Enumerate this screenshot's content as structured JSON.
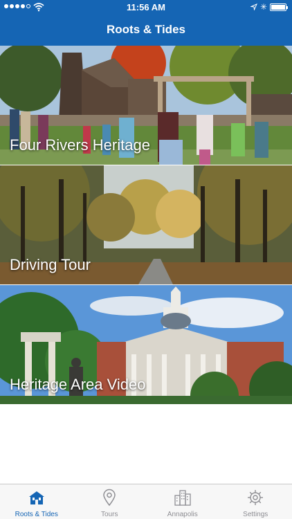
{
  "status_bar": {
    "time": "11:56 AM"
  },
  "nav": {
    "title": "Roots & Tides"
  },
  "cards": [
    {
      "label": "Four Rivers Heritage"
    },
    {
      "label": "Driving Tour"
    },
    {
      "label": "Heritage Area Video"
    }
  ],
  "tabs": [
    {
      "label": "Roots & Tides",
      "icon": "house-icon",
      "active": true
    },
    {
      "label": "Tours",
      "icon": "map-pin-icon",
      "active": false
    },
    {
      "label": "Annapolis",
      "icon": "city-buildings-icon",
      "active": false
    },
    {
      "label": "Settings",
      "icon": "gear-icon",
      "active": false
    }
  ],
  "colors": {
    "brand": "#1565b4",
    "tab_inactive": "#8e8e93"
  }
}
